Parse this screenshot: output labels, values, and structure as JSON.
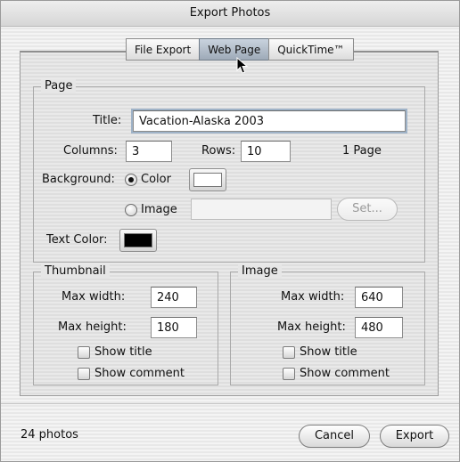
{
  "window": {
    "title": "Export Photos"
  },
  "tabs": [
    {
      "label": "File Export",
      "selected": false
    },
    {
      "label": "Web Page",
      "selected": true
    },
    {
      "label": "QuickTime™",
      "selected": false
    }
  ],
  "page": {
    "group_label": "Page",
    "title_label": "Title:",
    "title_value": "Vacation-Alaska 2003",
    "columns_label": "Columns:",
    "columns_value": "3",
    "rows_label": "Rows:",
    "rows_value": "10",
    "page_count": "1 Page",
    "background_label": "Background:",
    "color_option": "Color",
    "image_option": "Image",
    "image_path_value": "",
    "set_button": "Set...",
    "text_color_label": "Text Color:",
    "background_color": "#ffffff",
    "text_color": "#000000"
  },
  "thumbnail": {
    "group_label": "Thumbnail",
    "max_width_label": "Max width:",
    "max_width_value": "240",
    "max_height_label": "Max height:",
    "max_height_value": "180",
    "show_title": "Show title",
    "show_comment": "Show comment"
  },
  "image": {
    "group_label": "Image",
    "max_width_label": "Max width:",
    "max_width_value": "640",
    "max_height_label": "Max height:",
    "max_height_value": "480",
    "show_title": "Show title",
    "show_comment": "Show comment"
  },
  "footer": {
    "photo_count": "24 photos",
    "cancel_button": "Cancel",
    "export_button": "Export"
  },
  "icons": {
    "cursor": "arrow-cursor-icon"
  }
}
